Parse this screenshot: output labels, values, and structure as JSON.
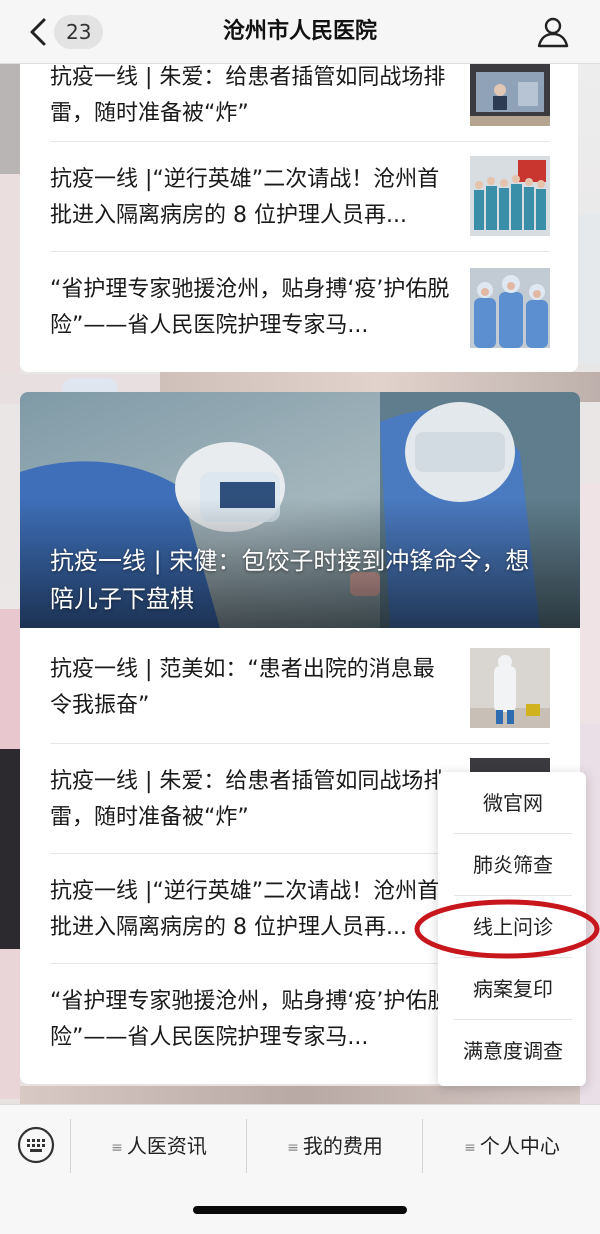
{
  "header": {
    "back_count": "23",
    "title": "沧州市人民医院"
  },
  "top_card": {
    "articles": [
      {
        "title": "抗疫一线 | 朱爱：给患者插管如同战场排雷，随时准备被“炸”"
      },
      {
        "title": "抗疫一线 |“逆行英雄”二次请战！沧州首批进入隔离病房的 8 位护理人员再..."
      },
      {
        "title": "“省护理专家驰援沧州，贴身搏‘疫’护佑脱险”——省人民医院护理专家马..."
      }
    ]
  },
  "main_card": {
    "hero_title": "抗疫一线 | 宋健：包饺子时接到冲锋命令，想陪儿子下盘棋",
    "articles": [
      {
        "title": "抗疫一线 | 范美如：“患者出院的消息最令我振奋”"
      },
      {
        "title": "抗疫一线 | 朱爱：给患者插管如同战场排雷，随时准备被“炸”"
      },
      {
        "title": "抗疫一线 |“逆行英雄”二次请战！沧州首批进入隔离病房的 8 位护理人员再..."
      },
      {
        "title": "“省护理专家驰援沧州，贴身搏‘疫’护佑脱险”——省人民医院护理专家马..."
      }
    ]
  },
  "popup_menu": {
    "items": [
      "微官网",
      "肺炎筛查",
      "线上问诊",
      "病案复印",
      "满意度调查"
    ],
    "highlighted": "线上问诊",
    "highlight_color": "#c8161d"
  },
  "bottom_nav": {
    "menu_marker": "≡",
    "items": [
      "人医资讯",
      "我的费用",
      "个人中心"
    ]
  },
  "icons": {
    "back": "chevron-left-icon",
    "user": "user-icon",
    "keyboard": "keyboard-icon"
  }
}
